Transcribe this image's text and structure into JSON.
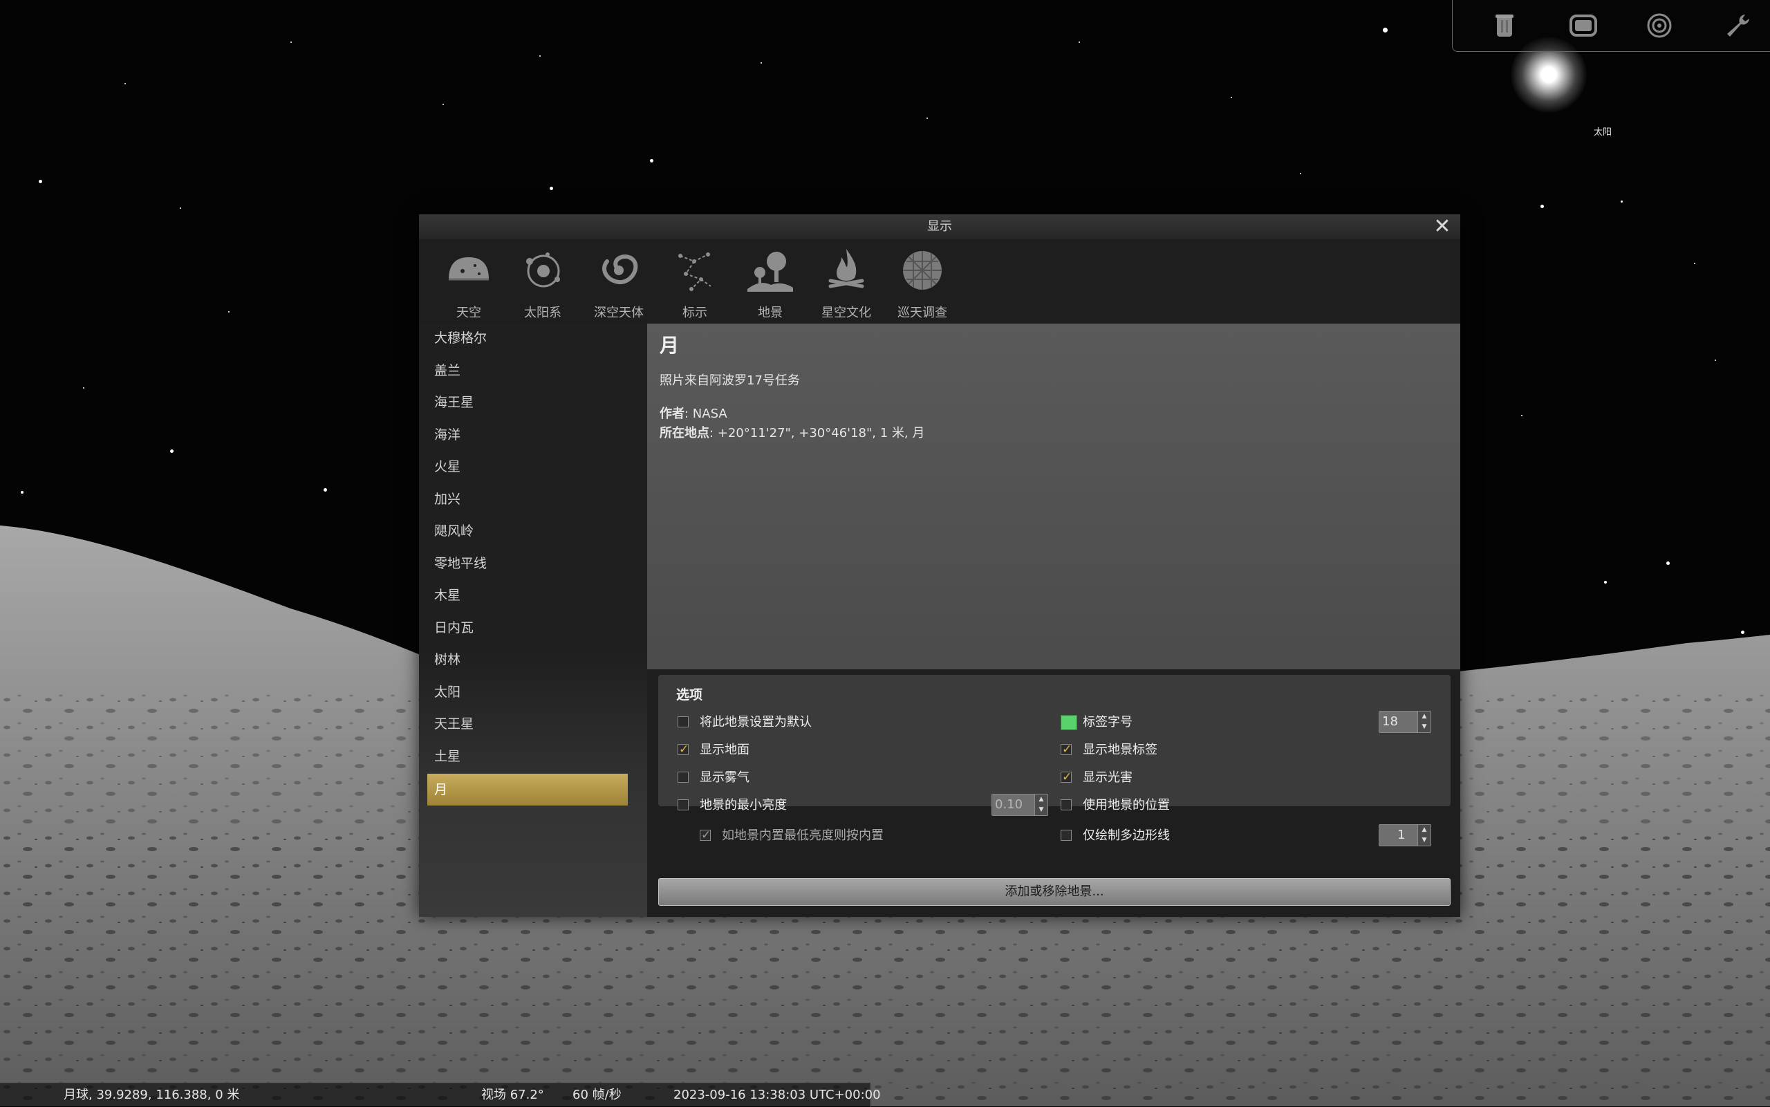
{
  "sky": {
    "sun_label": "太阳"
  },
  "toolbar": {
    "buttons": [
      {
        "icon": "trash-can-icon"
      },
      {
        "icon": "screen-icon"
      },
      {
        "icon": "target-icon"
      },
      {
        "icon": "wrench-icon"
      }
    ]
  },
  "dialog": {
    "title": "显示",
    "close_glyph": "✕",
    "tabs": [
      {
        "label": "天空",
        "icon": "sky-icon"
      },
      {
        "label": "太阳系",
        "icon": "solar-system-icon"
      },
      {
        "label": "深空天体",
        "icon": "galaxy-icon"
      },
      {
        "label": "标示",
        "icon": "constellation-icon"
      },
      {
        "label": "地景",
        "icon": "landscape-icon"
      },
      {
        "label": "星空文化",
        "icon": "campfire-icon"
      },
      {
        "label": "巡天调查",
        "icon": "survey-sphere-icon"
      }
    ],
    "landscapes": [
      {
        "label": "大穆格尔"
      },
      {
        "label": "盖兰"
      },
      {
        "label": "海王星"
      },
      {
        "label": "海洋"
      },
      {
        "label": "火星"
      },
      {
        "label": "加兴"
      },
      {
        "label": "飓风岭"
      },
      {
        "label": "零地平线"
      },
      {
        "label": "木星"
      },
      {
        "label": "日内瓦"
      },
      {
        "label": "树林"
      },
      {
        "label": "太阳"
      },
      {
        "label": "天王星"
      },
      {
        "label": "土星"
      },
      {
        "label": "月",
        "selected": true
      }
    ],
    "info": {
      "title": "月",
      "description": "照片来自阿波罗17号任务",
      "author_key": "作者",
      "author_value": ": NASA",
      "location_key": "所在地点",
      "location_value": ": +20°11'27\", +30°46'18\", 1 米, 月"
    },
    "options": {
      "title": "选项",
      "set_default": {
        "label": "将此地景设置为默认",
        "checked": false
      },
      "show_ground": {
        "label": "显示地面",
        "checked": true
      },
      "show_fog": {
        "label": "显示雾气",
        "checked": false
      },
      "min_brightness": {
        "label": "地景的最小亮度",
        "checked": false,
        "value": "0.10"
      },
      "use_builtin_brightness": {
        "label": "如地景内置最低亮度则按内置",
        "checked": true,
        "disabled": true
      },
      "label_font_size": {
        "label": "标签字号",
        "value": "18",
        "color": "#58d26a"
      },
      "show_landscape_labels": {
        "label": "显示地景标签",
        "checked": true
      },
      "show_light_pollution": {
        "label": "显示光害",
        "checked": true
      },
      "use_landscape_location": {
        "label": "使用地景的位置",
        "checked": false
      },
      "polygon_only": {
        "label": "仅绘制多边形线",
        "checked": false,
        "value": "1"
      }
    },
    "add_remove_button": "添加或移除地景..."
  },
  "statusbar": {
    "location": "月球, 39.9289, 116.388, 0 米",
    "fov": "视场 67.2°",
    "fps": "60 帧/秒",
    "datetime": "2023-09-16 13:38:03 UTC+00:00"
  }
}
